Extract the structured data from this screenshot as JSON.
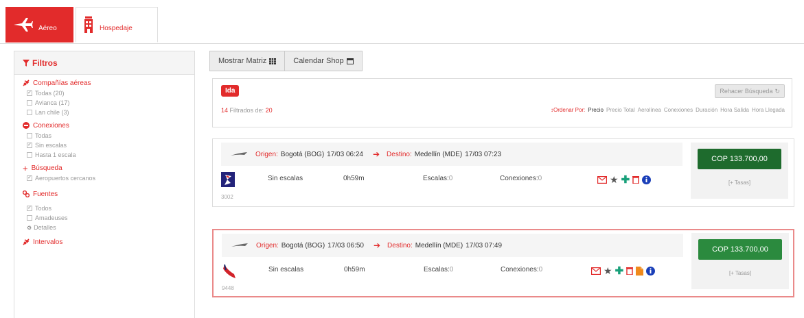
{
  "tabs": {
    "air": "Aéreo",
    "hotel": "Hospedaje"
  },
  "sidebar": {
    "title": "Filtros",
    "airlines": {
      "title": "Compañías aéreas",
      "options": [
        "Todas (20)",
        "Avianca (17)",
        "Lan chile (3)"
      ]
    },
    "connections": {
      "title": "Conexiones",
      "options": [
        "Todas",
        "Sin escalas",
        "Hasta 1 escala"
      ]
    },
    "search": {
      "title": "Búsqueda",
      "options": [
        "Aeropuertos cercanos"
      ]
    },
    "sources": {
      "title": "Fuentes",
      "options": [
        "Todos",
        "Amadeuses",
        "Detalles"
      ]
    },
    "next_title": "Intervalos"
  },
  "toolbar": {
    "matrix": "Mostrar Matriz",
    "calendar": "Calendar Shop"
  },
  "summary": {
    "direction": "Ida",
    "filtered_count": "14",
    "filtered_text": "Filtrados de:",
    "filtered_total": "20",
    "redo": "Rehacer Búsqueda",
    "sort_label": "Ordenar Por:",
    "sort_options": [
      "Precio",
      "Precio Total",
      "Aerolínea",
      "Conexiones",
      "Duración",
      "Hora Salida",
      "Hora Llegada"
    ]
  },
  "labels": {
    "origin": "Origen:",
    "destination": "Destino:",
    "stops": "Escalas:",
    "connections": "Conexiones:",
    "taxes": "[+ Tasas]"
  },
  "flights": [
    {
      "origin": "Bogotá (BOG)",
      "dep": "17/03 06:24",
      "destination": "Medellín (MDE)",
      "arr": "17/03 07:23",
      "flight_no": "3002",
      "type": "Sin escalas",
      "duration": "0h59m",
      "stops": "0",
      "connections": "0",
      "price": "COP 133.700,00",
      "airline_color": "#23237a"
    },
    {
      "origin": "Bogotá (BOG)",
      "dep": "17/03 06:50",
      "destination": "Medellín (MDE)",
      "arr": "17/03 07:49",
      "flight_no": "9448",
      "type": "Sin escalas",
      "duration": "0h59m",
      "stops": "0",
      "connections": "0",
      "price": "COP 133.700,00",
      "airline_color": "#d2232a"
    }
  ]
}
